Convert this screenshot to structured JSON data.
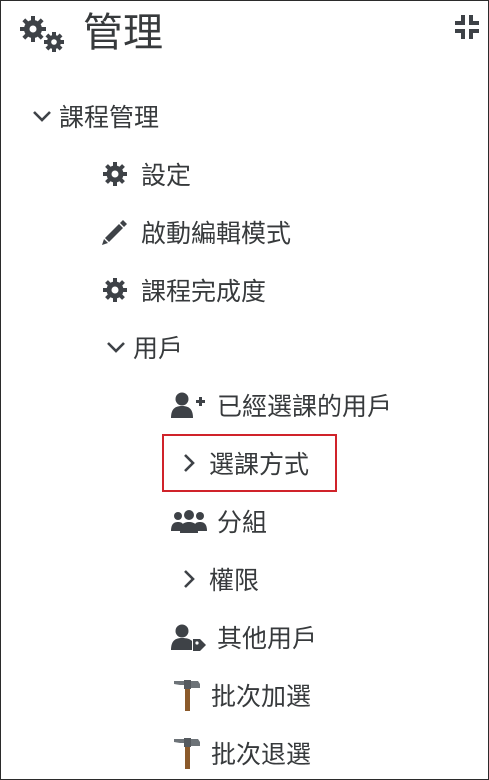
{
  "header": {
    "title": "管理",
    "cogs_icon": "cogs-icon",
    "collapse_icon": "compress-icon"
  },
  "tree": {
    "course_admin": {
      "label": "課程管理",
      "expanded": true
    },
    "settings": {
      "label": "設定",
      "icon": "gear-icon"
    },
    "edit_mode": {
      "label": "啟動編輯模式",
      "icon": "pencil-icon"
    },
    "completion": {
      "label": "課程完成度",
      "icon": "gear-icon"
    },
    "users": {
      "label": "用戶",
      "expanded": true
    },
    "enrolled_users": {
      "label": "已經選課的用戶",
      "icon": "user-plus-icon"
    },
    "enrolment_methods": {
      "label": "選課方式",
      "expanded": false,
      "highlighted": true
    },
    "groups": {
      "label": "分組",
      "icon": "users-icon"
    },
    "permissions": {
      "label": "權限",
      "expanded": false
    },
    "other_users": {
      "label": "其他用戶",
      "icon": "user-tag-icon"
    },
    "bulk_add": {
      "label": "批次加選",
      "icon": "hammer-icon"
    },
    "bulk_drop": {
      "label": "批次退選",
      "icon": "hammer-icon"
    }
  },
  "colors": {
    "text": "#373a3c",
    "icon": "#3e4247",
    "highlight": "#d0232a",
    "hammer_handle": "#8b5a2b",
    "hammer_head": "#6d7378"
  }
}
